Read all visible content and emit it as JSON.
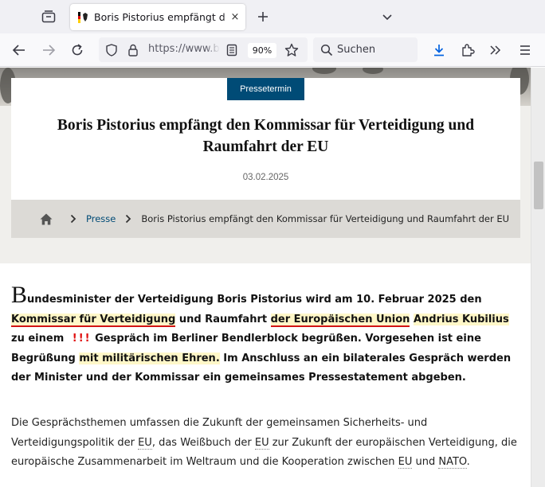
{
  "browser": {
    "tab_title": "Boris Pistorius empfängt den Kommissar für Verteidigung und Raumfahrt der EU",
    "tab_close": "×",
    "url": "https://www.bmvg.de",
    "zoom": "90%",
    "search_placeholder": "Suchen"
  },
  "header": {
    "badge": "Pressetermin",
    "title": "Boris Pistorius empfängt den Kommissar für Verteidigung und Raumfahrt der EU",
    "date": "03.02.2025"
  },
  "breadcrumb": {
    "link": "Presse",
    "current": "Boris Pistorius empfängt den Kommissar für Verteidigung und Raumfahrt der EU"
  },
  "body": {
    "lead": {
      "dropcap": "B",
      "t1": "undesminister der Verteidigung Boris Pistorius wird am 10. Februar 2025 den ",
      "h1": "Kommissar für Verteidigung",
      "t2": " und Raumfahrt ",
      "h2": "der Europäischen Union",
      "t3": " ",
      "h3": "Andrius Kubilius",
      "t4": " zu einem ",
      "marks": "!!!",
      "t5": " Gespräch im Berliner Bendlerblock begrüßen. Vorgesehen ist eine Begrüßung ",
      "h4": "mit militärischen Ehren.",
      "t6": " Im Anschluss an ein bilaterales Gespräch werden der Minister und der Kommissar ein gemeinsames Pressestatement abgeben."
    },
    "para2": {
      "t1": "Die Gesprächsthemen umfassen die Zukunft der gemeinsamen Sicherheits- und Verteidigungspolitik der ",
      "eu1": "EU",
      "t2": ", das Weißbuch der ",
      "eu2": "EU",
      "t3": " zur Zukunft der europäischen Verteidigung, die europäische Zusammenarbeit im Weltraum und die Kooperation zwischen ",
      "eu3": "EU",
      "t4": " und ",
      "nato": "NATO",
      "t5": "."
    }
  },
  "colors": {
    "badge_bg": "#004b76",
    "highlight": "#fff7c8",
    "underline": "#d21414",
    "breadcrumb_bg": "#dcdad6"
  },
  "icons": [
    "tab-list-icon",
    "eagle-favicon-icon",
    "plus-icon",
    "chevron-down-icon",
    "back-arrow-icon",
    "forward-arrow-icon",
    "reload-icon",
    "shield-icon",
    "lock-icon",
    "reader-view-icon",
    "star-icon",
    "search-icon",
    "download-icon",
    "extensions-icon",
    "overflow-chevrons-icon",
    "hamburger-menu-icon",
    "home-icon",
    "chevron-right-icon"
  ]
}
